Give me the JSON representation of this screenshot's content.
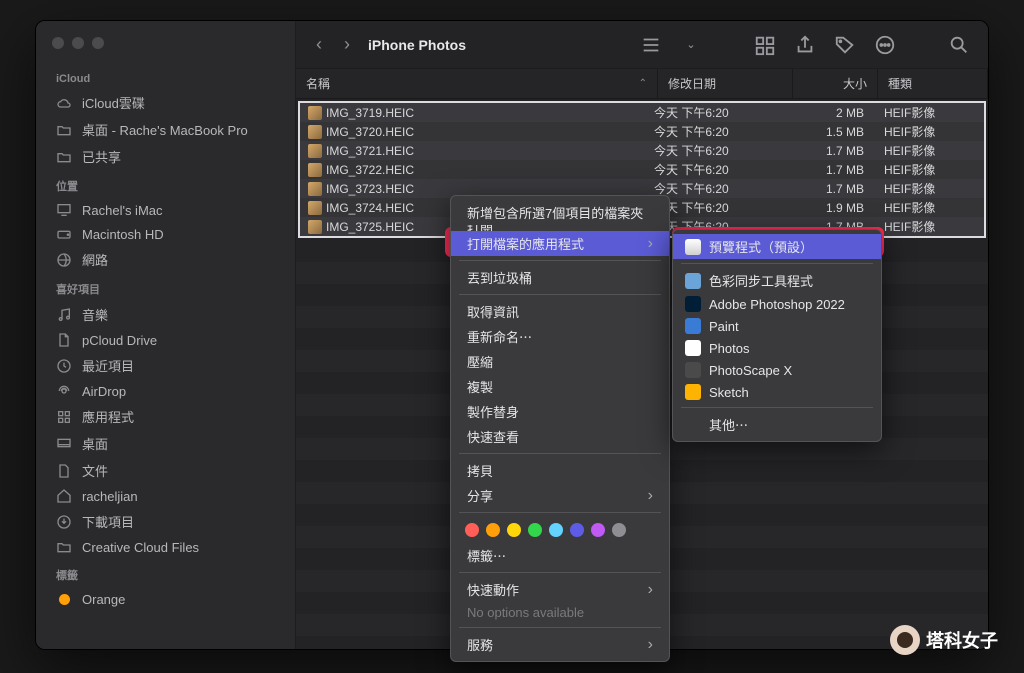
{
  "title": "iPhone Photos",
  "sidebar": {
    "sections": [
      {
        "label": "iCloud",
        "items": [
          {
            "icon": "cloud",
            "label": "iCloud雲碟"
          },
          {
            "icon": "folder",
            "label": "桌面 - Rache's MacBook Pro"
          },
          {
            "icon": "folder",
            "label": "已共享"
          }
        ]
      },
      {
        "label": "位置",
        "items": [
          {
            "icon": "display",
            "label": "Rachel's iMac"
          },
          {
            "icon": "disk",
            "label": "Macintosh HD"
          },
          {
            "icon": "globe",
            "label": "網路"
          }
        ]
      },
      {
        "label": "喜好項目",
        "items": [
          {
            "icon": "music",
            "label": "音樂"
          },
          {
            "icon": "file",
            "label": "pCloud Drive"
          },
          {
            "icon": "clock",
            "label": "最近項目"
          },
          {
            "icon": "airdrop",
            "label": "AirDrop"
          },
          {
            "icon": "apps",
            "label": "應用程式"
          },
          {
            "icon": "desktop",
            "label": "桌面"
          },
          {
            "icon": "doc",
            "label": "文件"
          },
          {
            "icon": "home",
            "label": "racheljian"
          },
          {
            "icon": "download",
            "label": "下載項目"
          },
          {
            "icon": "folder",
            "label": "Creative Cloud Files"
          }
        ]
      },
      {
        "label": "標籤",
        "items": [
          {
            "icon": "tag",
            "label": "Orange"
          }
        ]
      }
    ]
  },
  "columns": {
    "name": "名稱",
    "date": "修改日期",
    "size": "大小",
    "kind": "種類"
  },
  "files": [
    {
      "name": "IMG_3719.HEIC",
      "date": "今天 下午6:20",
      "size": "2 MB",
      "kind": "HEIF影像"
    },
    {
      "name": "IMG_3720.HEIC",
      "date": "今天 下午6:20",
      "size": "1.5 MB",
      "kind": "HEIF影像"
    },
    {
      "name": "IMG_3721.HEIC",
      "date": "今天 下午6:20",
      "size": "1.7 MB",
      "kind": "HEIF影像"
    },
    {
      "name": "IMG_3722.HEIC",
      "date": "今天 下午6:20",
      "size": "1.7 MB",
      "kind": "HEIF影像"
    },
    {
      "name": "IMG_3723.HEIC",
      "date": "今天 下午6:20",
      "size": "1.7 MB",
      "kind": "HEIF影像"
    },
    {
      "name": "IMG_3724.HEIC",
      "date": "今天 下午6:20",
      "size": "1.9 MB",
      "kind": "HEIF影像"
    },
    {
      "name": "IMG_3725.HEIC",
      "date": "今天 下午6:20",
      "size": "1.7 MB",
      "kind": "HEIF影像"
    }
  ],
  "ctx": {
    "new_folder": "新增包含所選7個項目的檔案夾",
    "open": "打開",
    "open_with": "打開檔案的應用程式",
    "trash": "丟到垃圾桶",
    "get_info": "取得資訊",
    "rename": "重新命名⋯",
    "compress": "壓縮",
    "duplicate": "複製",
    "alias": "製作替身",
    "quicklook": "快速查看",
    "copy": "拷貝",
    "share": "分享",
    "tags_label": "標籤⋯",
    "quick_actions": "快速動作",
    "no_options": "No options available",
    "services": "服務"
  },
  "submenu": {
    "default": "預覽程式（預設）",
    "apps": [
      {
        "label": "色彩同步工具程式",
        "color": "#6ba4d8"
      },
      {
        "label": "Adobe Photoshop 2022",
        "color": "#001e36"
      },
      {
        "label": "Paint",
        "color": "#3a7bd5"
      },
      {
        "label": "Photos",
        "color": "#ffffff"
      },
      {
        "label": "PhotoScape X",
        "color": "#4a4a4a"
      },
      {
        "label": "Sketch",
        "color": "#fdb300"
      }
    ],
    "other": "其他⋯"
  },
  "swatch_colors": [
    "#ff5f57",
    "#ff9f0a",
    "#ffd60a",
    "#32d74b",
    "#64d2ff",
    "#5e5ce6",
    "#bf5af2",
    "#8e8e93"
  ],
  "brand": "塔科女子"
}
